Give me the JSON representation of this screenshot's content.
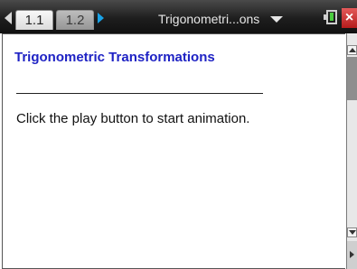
{
  "topbar": {
    "tabs": [
      {
        "label": "1.1"
      },
      {
        "label": "1.2"
      }
    ],
    "document_title": "Trigonometri...ons"
  },
  "main": {
    "heading": "Trigonometric Transformations",
    "instruction": "Click the play button to start animation."
  },
  "colors": {
    "heading": "#1e22c4",
    "accent_arrow": "#19a2e6",
    "battery": "#4ccd3f",
    "close": "#c52a2a"
  },
  "icons": {
    "prev": "left-arrow-icon",
    "next": "right-arrow-icon",
    "menu": "chevron-down-icon",
    "battery": "battery-icon",
    "close": "close-icon"
  }
}
